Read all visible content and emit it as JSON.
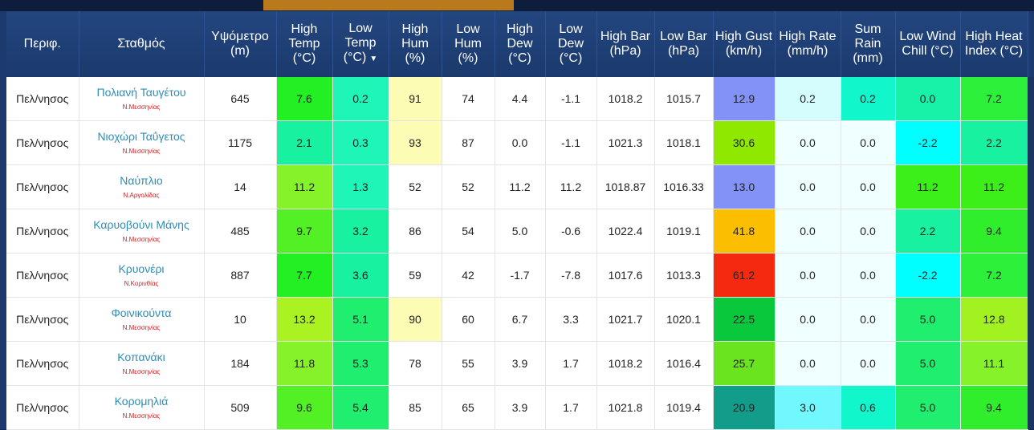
{
  "headers": [
    {
      "id": "region",
      "lines": [
        "Περιφ."
      ]
    },
    {
      "id": "station",
      "lines": [
        "Σταθμός"
      ]
    },
    {
      "id": "altitude",
      "lines": [
        "Υψόμετρο",
        "(m)"
      ]
    },
    {
      "id": "high_temp",
      "lines": [
        "High",
        "Temp",
        "(°C)"
      ]
    },
    {
      "id": "low_temp",
      "lines": [
        "Low",
        "Temp",
        "(°C)"
      ],
      "sorted": true,
      "sort_glyph": "▼"
    },
    {
      "id": "high_hum",
      "lines": [
        "High",
        "Hum",
        "(%)"
      ]
    },
    {
      "id": "low_hum",
      "lines": [
        "Low",
        "Hum",
        "(%)"
      ]
    },
    {
      "id": "high_dew",
      "lines": [
        "High",
        "Dew",
        "(°C)"
      ]
    },
    {
      "id": "low_dew",
      "lines": [
        "Low",
        "Dew",
        "(°C)"
      ]
    },
    {
      "id": "high_bar",
      "lines": [
        "High Bar",
        "(hPa)"
      ]
    },
    {
      "id": "low_bar",
      "lines": [
        "Low Bar",
        "(hPa)"
      ]
    },
    {
      "id": "high_gust",
      "lines": [
        "High Gust",
        "(km/h)"
      ]
    },
    {
      "id": "high_rate",
      "lines": [
        "High Rate",
        "(mm/h)"
      ]
    },
    {
      "id": "sum_rain",
      "lines": [
        "Sum",
        "Rain",
        "(mm)"
      ]
    },
    {
      "id": "low_wind_chill",
      "lines": [
        "Low Wind",
        "Chill (°C)"
      ]
    },
    {
      "id": "high_heat_index",
      "lines": [
        "High Heat",
        "Index (°C)"
      ]
    }
  ],
  "rows": [
    {
      "region": "Πελ/νησος",
      "station": "Πολιανή Ταυγέτου",
      "prefecture": "Ν.Μεσσηνίας",
      "altitude": "645",
      "cells": [
        {
          "v": "7.6",
          "c": "#22f022"
        },
        {
          "v": "0.2",
          "c": "#1ef5b6"
        },
        {
          "v": "91",
          "c": "#fcfcb4"
        },
        {
          "v": "74",
          "c": "#ffffff"
        },
        {
          "v": "4.4",
          "c": "#ffffff"
        },
        {
          "v": "-1.1",
          "c": "#ffffff"
        },
        {
          "v": "1018.2",
          "c": "#ffffff"
        },
        {
          "v": "1015.7",
          "c": "#ffffff"
        },
        {
          "v": "12.9",
          "c": "#8392f6"
        },
        {
          "v": "0.2",
          "c": "#d6fdfd"
        },
        {
          "v": "0.2",
          "c": "#12f6cc"
        },
        {
          "v": "0.0",
          "c": "#18f2a8"
        },
        {
          "v": "7.2",
          "c": "#2cf03a"
        }
      ]
    },
    {
      "region": "Πελ/νησος",
      "station": "Νιοχώρι Ταΰγετος",
      "prefecture": "Ν.Μεσσηνίας",
      "altitude": "1175",
      "cells": [
        {
          "v": "2.1",
          "c": "#18f2a0"
        },
        {
          "v": "0.3",
          "c": "#1ef5b6"
        },
        {
          "v": "93",
          "c": "#fcfcb4"
        },
        {
          "v": "87",
          "c": "#ffffff"
        },
        {
          "v": "0.0",
          "c": "#ffffff"
        },
        {
          "v": "-1.1",
          "c": "#ffffff"
        },
        {
          "v": "1021.3",
          "c": "#ffffff"
        },
        {
          "v": "1018.1",
          "c": "#ffffff"
        },
        {
          "v": "30.6",
          "c": "#8ee800"
        },
        {
          "v": "0.0",
          "c": "#f0ffff"
        },
        {
          "v": "0.0",
          "c": "#f0ffff"
        },
        {
          "v": "-2.2",
          "c": "#00ffff"
        },
        {
          "v": "2.2",
          "c": "#18f2a0"
        }
      ]
    },
    {
      "region": "Πελ/νησος",
      "station": "Ναύπλιο",
      "prefecture": "Ν.Αργολίδας",
      "altitude": "14",
      "cells": [
        {
          "v": "11.2",
          "c": "#86f22a"
        },
        {
          "v": "1.3",
          "c": "#1ef5b6"
        },
        {
          "v": "52",
          "c": "#ffffff"
        },
        {
          "v": "52",
          "c": "#ffffff"
        },
        {
          "v": "11.2",
          "c": "#ffffff"
        },
        {
          "v": "11.2",
          "c": "#ffffff"
        },
        {
          "v": "1018.87",
          "c": "#ffffff"
        },
        {
          "v": "1016.33",
          "c": "#ffffff"
        },
        {
          "v": "13.0",
          "c": "#8392f6"
        },
        {
          "v": "0.0",
          "c": "#f0ffff"
        },
        {
          "v": "0.0",
          "c": "#f0ffff"
        },
        {
          "v": "11.2",
          "c": "#3cef18"
        },
        {
          "v": "11.2",
          "c": "#3cef18"
        }
      ]
    },
    {
      "region": "Πελ/νησος",
      "station": "Καρυοβούνι Μάνης",
      "prefecture": "Ν.Μεσσηνίας",
      "altitude": "485",
      "cells": [
        {
          "v": "9.7",
          "c": "#52f024"
        },
        {
          "v": "3.2",
          "c": "#18f2a0"
        },
        {
          "v": "86",
          "c": "#ffffff"
        },
        {
          "v": "54",
          "c": "#ffffff"
        },
        {
          "v": "5.0",
          "c": "#ffffff"
        },
        {
          "v": "-0.6",
          "c": "#ffffff"
        },
        {
          "v": "1022.4",
          "c": "#ffffff"
        },
        {
          "v": "1019.1",
          "c": "#ffffff"
        },
        {
          "v": "41.8",
          "c": "#fcbe00"
        },
        {
          "v": "0.0",
          "c": "#f0ffff"
        },
        {
          "v": "0.0",
          "c": "#f0ffff"
        },
        {
          "v": "2.2",
          "c": "#18f2a0"
        },
        {
          "v": "9.4",
          "c": "#30ee2c"
        }
      ]
    },
    {
      "region": "Πελ/νησος",
      "station": "Κρυονέρι",
      "prefecture": "Ν.Κορινθίας",
      "altitude": "887",
      "cells": [
        {
          "v": "7.7",
          "c": "#22f022"
        },
        {
          "v": "3.6",
          "c": "#18f2a0"
        },
        {
          "v": "59",
          "c": "#ffffff"
        },
        {
          "v": "42",
          "c": "#ffffff"
        },
        {
          "v": "-1.7",
          "c": "#ffffff"
        },
        {
          "v": "-7.8",
          "c": "#ffffff"
        },
        {
          "v": "1017.6",
          "c": "#ffffff"
        },
        {
          "v": "1013.3",
          "c": "#ffffff"
        },
        {
          "v": "61.2",
          "c": "#f42a10"
        },
        {
          "v": "0.0",
          "c": "#f0ffff"
        },
        {
          "v": "0.0",
          "c": "#f0ffff"
        },
        {
          "v": "-2.2",
          "c": "#00ffff"
        },
        {
          "v": "7.2",
          "c": "#2cf03a"
        }
      ]
    },
    {
      "region": "Πελ/νησος",
      "station": "Φοινικούντα",
      "prefecture": "Ν.Μεσσηνίας",
      "altitude": "10",
      "cells": [
        {
          "v": "13.2",
          "c": "#aaf222"
        },
        {
          "v": "5.1",
          "c": "#20ee6e"
        },
        {
          "v": "90",
          "c": "#fcfcb4"
        },
        {
          "v": "60",
          "c": "#ffffff"
        },
        {
          "v": "6.7",
          "c": "#ffffff"
        },
        {
          "v": "3.3",
          "c": "#ffffff"
        },
        {
          "v": "1021.7",
          "c": "#ffffff"
        },
        {
          "v": "1020.1",
          "c": "#ffffff"
        },
        {
          "v": "22.5",
          "c": "#0ac83c"
        },
        {
          "v": "0.0",
          "c": "#f0ffff"
        },
        {
          "v": "0.0",
          "c": "#f0ffff"
        },
        {
          "v": "5.0",
          "c": "#20ee6e"
        },
        {
          "v": "12.8",
          "c": "#a2f222"
        }
      ]
    },
    {
      "region": "Πελ/νησος",
      "station": "Κοπανάκι",
      "prefecture": "Ν.Μεσσηνίας",
      "altitude": "184",
      "cells": [
        {
          "v": "11.8",
          "c": "#86f22a"
        },
        {
          "v": "5.3",
          "c": "#20ee6e"
        },
        {
          "v": "78",
          "c": "#ffffff"
        },
        {
          "v": "55",
          "c": "#ffffff"
        },
        {
          "v": "3.9",
          "c": "#ffffff"
        },
        {
          "v": "1.7",
          "c": "#ffffff"
        },
        {
          "v": "1018.2",
          "c": "#ffffff"
        },
        {
          "v": "1016.4",
          "c": "#ffffff"
        },
        {
          "v": "25.7",
          "c": "#6ae41e"
        },
        {
          "v": "0.0",
          "c": "#f0ffff"
        },
        {
          "v": "0.0",
          "c": "#f0ffff"
        },
        {
          "v": "5.0",
          "c": "#20ee6e"
        },
        {
          "v": "11.1",
          "c": "#86f22a"
        }
      ]
    },
    {
      "region": "Πελ/νησος",
      "station": "Κορομηλιά",
      "prefecture": "Ν.Μεσσηνίας",
      "altitude": "509",
      "cells": [
        {
          "v": "9.6",
          "c": "#52f024"
        },
        {
          "v": "5.4",
          "c": "#20ee6e"
        },
        {
          "v": "85",
          "c": "#ffffff"
        },
        {
          "v": "65",
          "c": "#ffffff"
        },
        {
          "v": "3.9",
          "c": "#ffffff"
        },
        {
          "v": "1.7",
          "c": "#ffffff"
        },
        {
          "v": "1021.8",
          "c": "#ffffff"
        },
        {
          "v": "1019.4",
          "c": "#ffffff"
        },
        {
          "v": "20.9",
          "c": "#129c8a"
        },
        {
          "v": "3.0",
          "c": "#70f8fe"
        },
        {
          "v": "0.6",
          "c": "#12f6cc"
        },
        {
          "v": "5.0",
          "c": "#20ee6e"
        },
        {
          "v": "9.4",
          "c": "#30ee2c"
        }
      ]
    }
  ]
}
